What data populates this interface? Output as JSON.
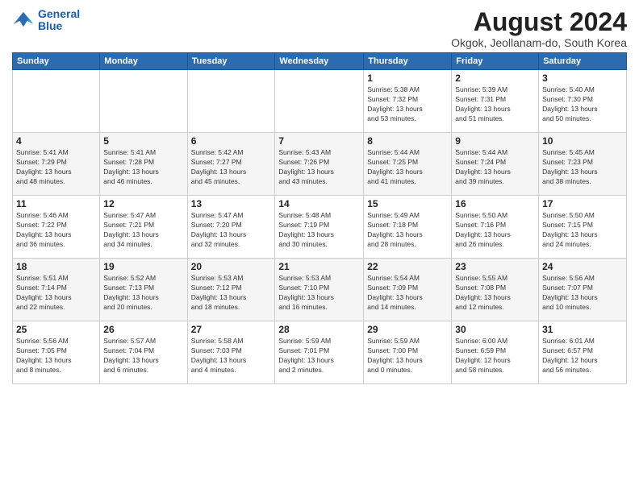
{
  "header": {
    "logo_line1": "General",
    "logo_line2": "Blue",
    "month_year": "August 2024",
    "location": "Okgok, Jeollanam-do, South Korea"
  },
  "weekdays": [
    "Sunday",
    "Monday",
    "Tuesday",
    "Wednesday",
    "Thursday",
    "Friday",
    "Saturday"
  ],
  "weeks": [
    [
      {
        "day": "",
        "info": ""
      },
      {
        "day": "",
        "info": ""
      },
      {
        "day": "",
        "info": ""
      },
      {
        "day": "",
        "info": ""
      },
      {
        "day": "1",
        "info": "Sunrise: 5:38 AM\nSunset: 7:32 PM\nDaylight: 13 hours\nand 53 minutes."
      },
      {
        "day": "2",
        "info": "Sunrise: 5:39 AM\nSunset: 7:31 PM\nDaylight: 13 hours\nand 51 minutes."
      },
      {
        "day": "3",
        "info": "Sunrise: 5:40 AM\nSunset: 7:30 PM\nDaylight: 13 hours\nand 50 minutes."
      }
    ],
    [
      {
        "day": "4",
        "info": "Sunrise: 5:41 AM\nSunset: 7:29 PM\nDaylight: 13 hours\nand 48 minutes."
      },
      {
        "day": "5",
        "info": "Sunrise: 5:41 AM\nSunset: 7:28 PM\nDaylight: 13 hours\nand 46 minutes."
      },
      {
        "day": "6",
        "info": "Sunrise: 5:42 AM\nSunset: 7:27 PM\nDaylight: 13 hours\nand 45 minutes."
      },
      {
        "day": "7",
        "info": "Sunrise: 5:43 AM\nSunset: 7:26 PM\nDaylight: 13 hours\nand 43 minutes."
      },
      {
        "day": "8",
        "info": "Sunrise: 5:44 AM\nSunset: 7:25 PM\nDaylight: 13 hours\nand 41 minutes."
      },
      {
        "day": "9",
        "info": "Sunrise: 5:44 AM\nSunset: 7:24 PM\nDaylight: 13 hours\nand 39 minutes."
      },
      {
        "day": "10",
        "info": "Sunrise: 5:45 AM\nSunset: 7:23 PM\nDaylight: 13 hours\nand 38 minutes."
      }
    ],
    [
      {
        "day": "11",
        "info": "Sunrise: 5:46 AM\nSunset: 7:22 PM\nDaylight: 13 hours\nand 36 minutes."
      },
      {
        "day": "12",
        "info": "Sunrise: 5:47 AM\nSunset: 7:21 PM\nDaylight: 13 hours\nand 34 minutes."
      },
      {
        "day": "13",
        "info": "Sunrise: 5:47 AM\nSunset: 7:20 PM\nDaylight: 13 hours\nand 32 minutes."
      },
      {
        "day": "14",
        "info": "Sunrise: 5:48 AM\nSunset: 7:19 PM\nDaylight: 13 hours\nand 30 minutes."
      },
      {
        "day": "15",
        "info": "Sunrise: 5:49 AM\nSunset: 7:18 PM\nDaylight: 13 hours\nand 28 minutes."
      },
      {
        "day": "16",
        "info": "Sunrise: 5:50 AM\nSunset: 7:16 PM\nDaylight: 13 hours\nand 26 minutes."
      },
      {
        "day": "17",
        "info": "Sunrise: 5:50 AM\nSunset: 7:15 PM\nDaylight: 13 hours\nand 24 minutes."
      }
    ],
    [
      {
        "day": "18",
        "info": "Sunrise: 5:51 AM\nSunset: 7:14 PM\nDaylight: 13 hours\nand 22 minutes."
      },
      {
        "day": "19",
        "info": "Sunrise: 5:52 AM\nSunset: 7:13 PM\nDaylight: 13 hours\nand 20 minutes."
      },
      {
        "day": "20",
        "info": "Sunrise: 5:53 AM\nSunset: 7:12 PM\nDaylight: 13 hours\nand 18 minutes."
      },
      {
        "day": "21",
        "info": "Sunrise: 5:53 AM\nSunset: 7:10 PM\nDaylight: 13 hours\nand 16 minutes."
      },
      {
        "day": "22",
        "info": "Sunrise: 5:54 AM\nSunset: 7:09 PM\nDaylight: 13 hours\nand 14 minutes."
      },
      {
        "day": "23",
        "info": "Sunrise: 5:55 AM\nSunset: 7:08 PM\nDaylight: 13 hours\nand 12 minutes."
      },
      {
        "day": "24",
        "info": "Sunrise: 5:56 AM\nSunset: 7:07 PM\nDaylight: 13 hours\nand 10 minutes."
      }
    ],
    [
      {
        "day": "25",
        "info": "Sunrise: 5:56 AM\nSunset: 7:05 PM\nDaylight: 13 hours\nand 8 minutes."
      },
      {
        "day": "26",
        "info": "Sunrise: 5:57 AM\nSunset: 7:04 PM\nDaylight: 13 hours\nand 6 minutes."
      },
      {
        "day": "27",
        "info": "Sunrise: 5:58 AM\nSunset: 7:03 PM\nDaylight: 13 hours\nand 4 minutes."
      },
      {
        "day": "28",
        "info": "Sunrise: 5:59 AM\nSunset: 7:01 PM\nDaylight: 13 hours\nand 2 minutes."
      },
      {
        "day": "29",
        "info": "Sunrise: 5:59 AM\nSunset: 7:00 PM\nDaylight: 13 hours\nand 0 minutes."
      },
      {
        "day": "30",
        "info": "Sunrise: 6:00 AM\nSunset: 6:59 PM\nDaylight: 12 hours\nand 58 minutes."
      },
      {
        "day": "31",
        "info": "Sunrise: 6:01 AM\nSunset: 6:57 PM\nDaylight: 12 hours\nand 56 minutes."
      }
    ]
  ]
}
